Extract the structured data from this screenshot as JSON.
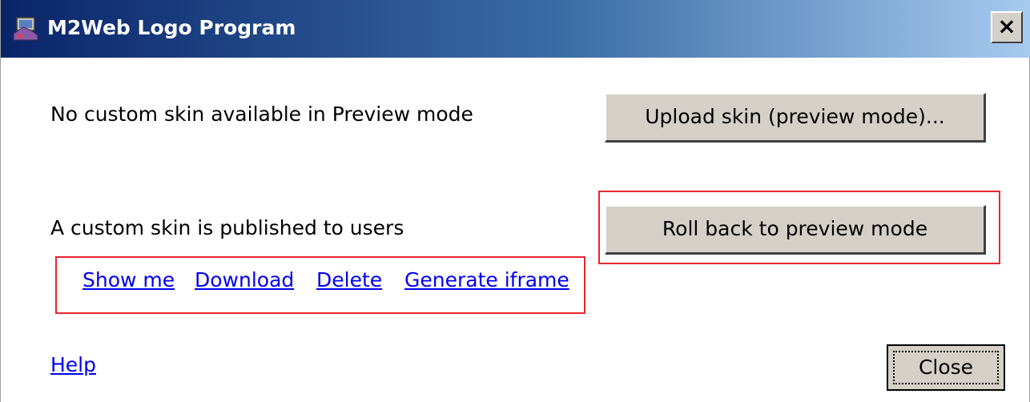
{
  "window": {
    "title": "M2Web Logo Program",
    "close_glyph": "×"
  },
  "preview": {
    "status_text": "No custom skin available in Preview mode",
    "upload_button": "Upload skin (preview mode)..."
  },
  "published": {
    "status_text": "A custom skin is published to users",
    "rollback_button": "Roll back to preview mode",
    "links": {
      "show_me": "Show me",
      "download": "Download",
      "delete": "Delete",
      "generate_iframe": "Generate iframe"
    }
  },
  "footer": {
    "help_link": "Help",
    "close_button": "Close"
  },
  "colors": {
    "titlebar_start": "#0a246a",
    "titlebar_end": "#a6caf0",
    "link": "#0000ee",
    "highlight": "#e8262f",
    "button_face": "#d4d0c8"
  }
}
